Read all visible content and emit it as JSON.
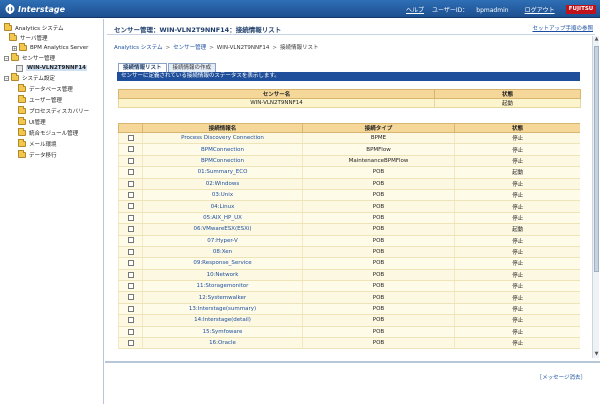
{
  "topbar": {
    "brand": "Interstage",
    "help": "ヘルプ",
    "user_label": "ユーザーID：",
    "user_id": "bpmadmin",
    "logout": "ログアウト",
    "vendor": "FUJITSU"
  },
  "tree": {
    "root": "Analytics システム",
    "server_mgmt": "サーバ管理",
    "bpm_server": "BPM Analytics Server",
    "sensor_mgmt": "センサー管理",
    "sensor_item": "WIN-VLN2T9NNF14",
    "sys_settings": "システム設定",
    "children": [
      "データベース管理",
      "ユーザー管理",
      "プロセスディスカバリー",
      "UI管理",
      "統合モジュール管理",
      "メール環境",
      "データ移行"
    ]
  },
  "header": {
    "title": "センサー管理：WIN-VLN2T9NNF14：接続情報リスト",
    "setup_link": "セットアップ手順の参照"
  },
  "breadcrumb": [
    "Analytics システム",
    "センサー管理",
    "WIN-VLN2T9NNF14",
    "接続情報リスト"
  ],
  "tabs": [
    "接続情報リスト",
    "接続情報の作成"
  ],
  "info_bar": "センサーに定義されている接続情報のステータスを表示します。",
  "sensor_table": {
    "headers": [
      "センサー名",
      "状態"
    ],
    "row": [
      "WIN-VLN2T9NNF14",
      "起動"
    ]
  },
  "conn_table": {
    "headers": [
      "",
      "接続情報名",
      "接続タイプ",
      "状態"
    ],
    "rows": [
      {
        "name": "Process Discovery Connection",
        "type": "BPME",
        "status": "停止"
      },
      {
        "name": "BPMConnection",
        "type": "BPMFlow",
        "status": "停止"
      },
      {
        "name": "BPMConnection",
        "type": "MaintenanceBPMFlow",
        "status": "停止"
      },
      {
        "name": "01:Summary_ECO",
        "type": "POB",
        "status": "起動"
      },
      {
        "name": "02:Windows",
        "type": "POB",
        "status": "停止"
      },
      {
        "name": "03:Unix",
        "type": "POB",
        "status": "停止"
      },
      {
        "name": "04:Linux",
        "type": "POB",
        "status": "停止"
      },
      {
        "name": "05:AIX_HP_UX",
        "type": "POB",
        "status": "停止"
      },
      {
        "name": "06:VMwareESX(ESXi)",
        "type": "POB",
        "status": "起動"
      },
      {
        "name": "07:Hyper-V",
        "type": "POB",
        "status": "停止"
      },
      {
        "name": "08:Xen",
        "type": "POB",
        "status": "停止"
      },
      {
        "name": "09:Response_Service",
        "type": "POB",
        "status": "停止"
      },
      {
        "name": "10:Network",
        "type": "POB",
        "status": "停止"
      },
      {
        "name": "11:Storagemonitor",
        "type": "POB",
        "status": "停止"
      },
      {
        "name": "12:Systemwalker",
        "type": "POB",
        "status": "停止"
      },
      {
        "name": "13:Interstage(summary)",
        "type": "POB",
        "status": "停止"
      },
      {
        "name": "14:Interstage(detail)",
        "type": "POB",
        "status": "停止"
      },
      {
        "name": "15:Symfoware",
        "type": "POB",
        "status": "停止"
      },
      {
        "name": "16:Oracle",
        "type": "POB",
        "status": "停止"
      }
    ]
  },
  "messages": {
    "clear": "［メッセージ消去］"
  },
  "colors": {
    "topbar": "#2f6fb6",
    "info_bar": "#1f4e9a",
    "table_header": "#f5d79a",
    "link": "#1a4fa0"
  }
}
